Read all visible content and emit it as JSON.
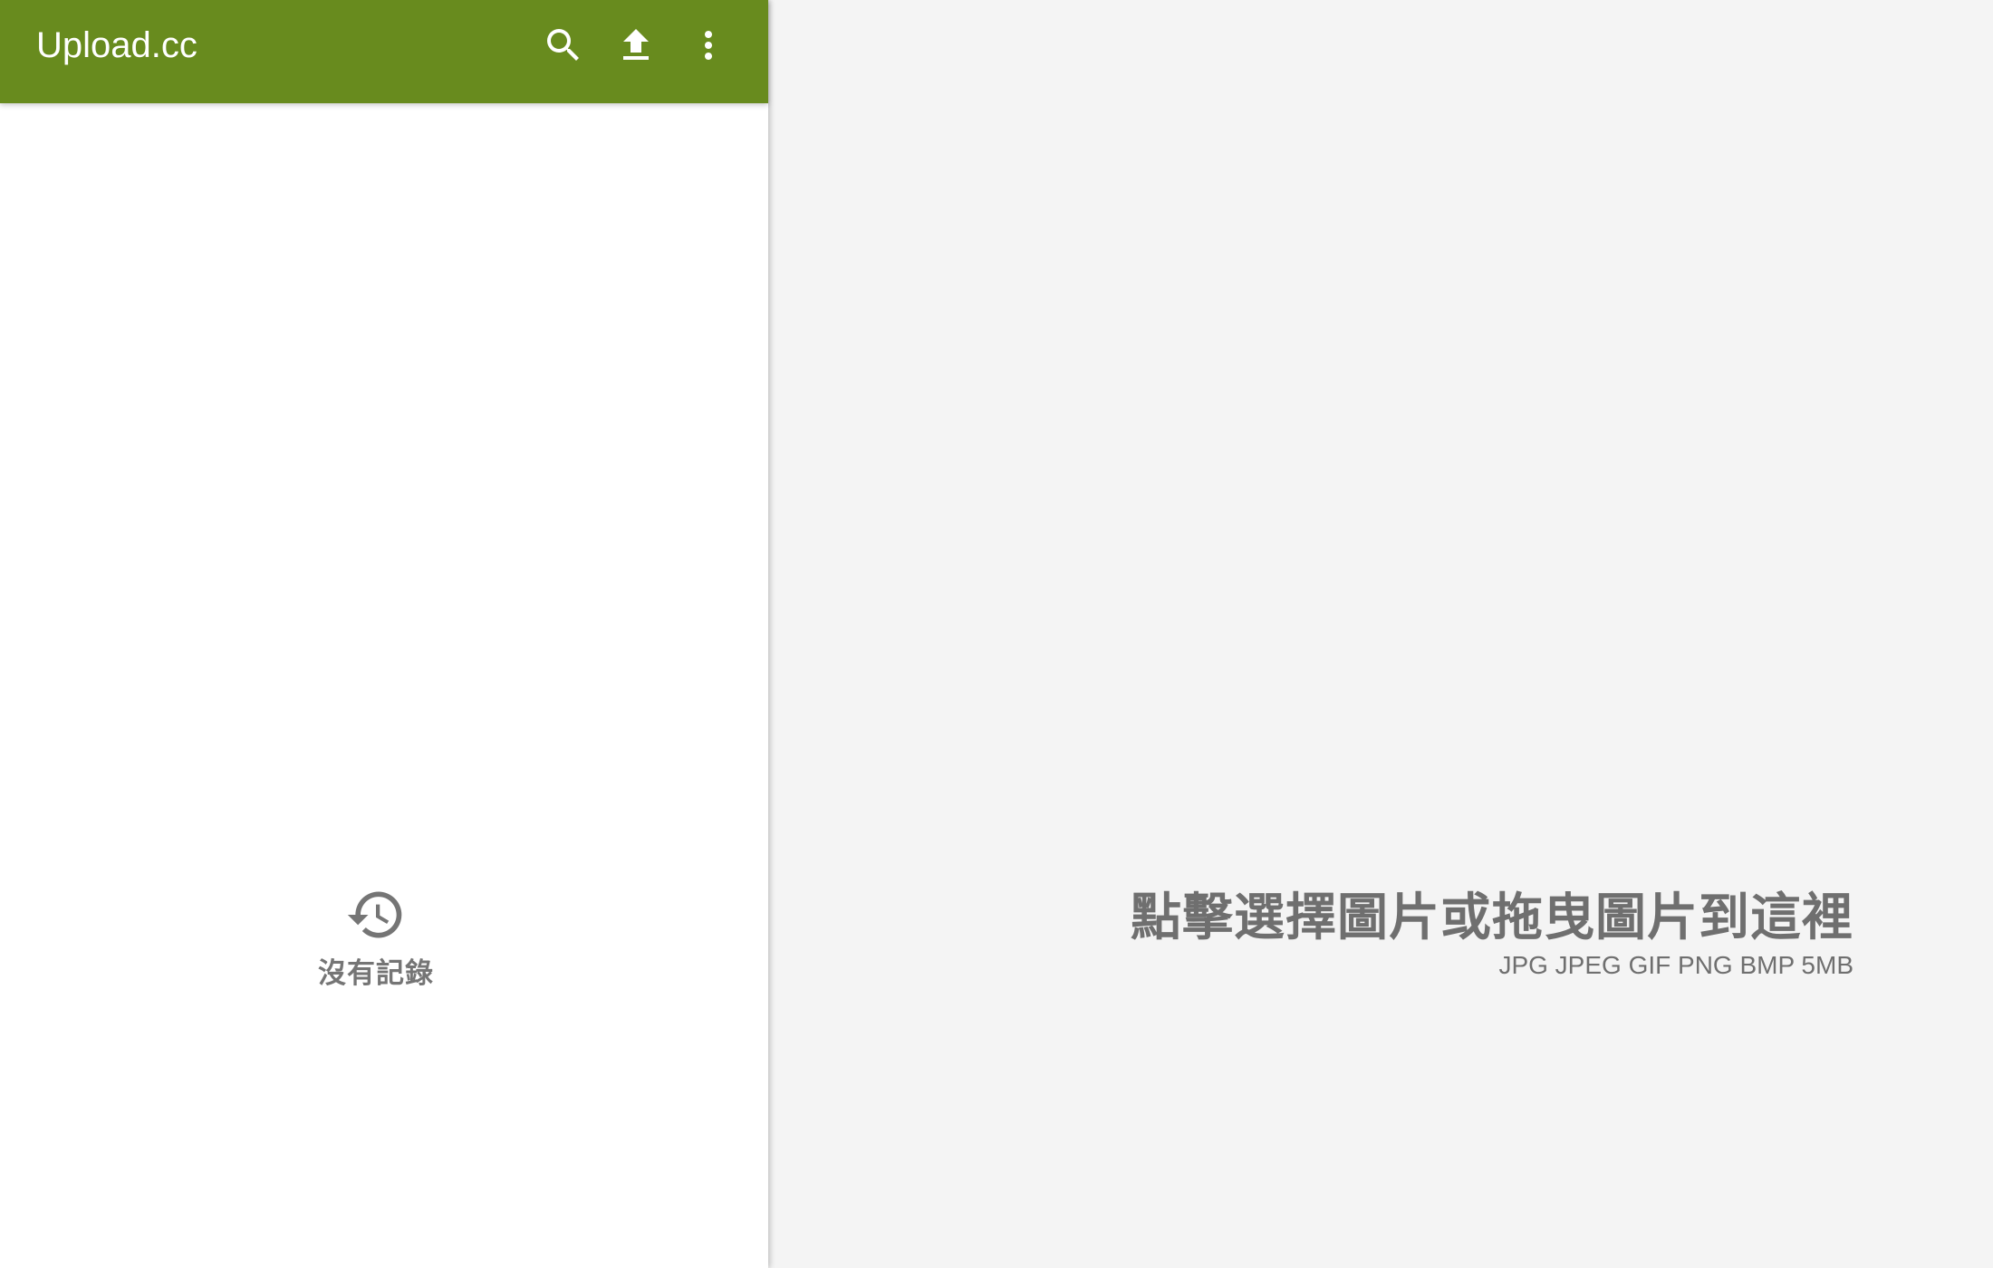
{
  "colors": {
    "appbar": "#688b1e",
    "appbar_text": "#ffffff",
    "sidebar_bg": "#ffffff",
    "dropzone_bg": "#f4f4f4",
    "muted_text": "#757575"
  },
  "appbar": {
    "title": "Upload.cc",
    "actions": [
      {
        "icon": "search-icon"
      },
      {
        "icon": "upload-icon"
      },
      {
        "icon": "more-vert-icon"
      }
    ]
  },
  "history": {
    "icon": "history-icon",
    "empty_label": "沒有記錄"
  },
  "dropzone": {
    "title": "點擊選擇圖片或拖曳圖片到這裡",
    "subtitle": "JPG JPEG GIF PNG BMP 5MB"
  }
}
